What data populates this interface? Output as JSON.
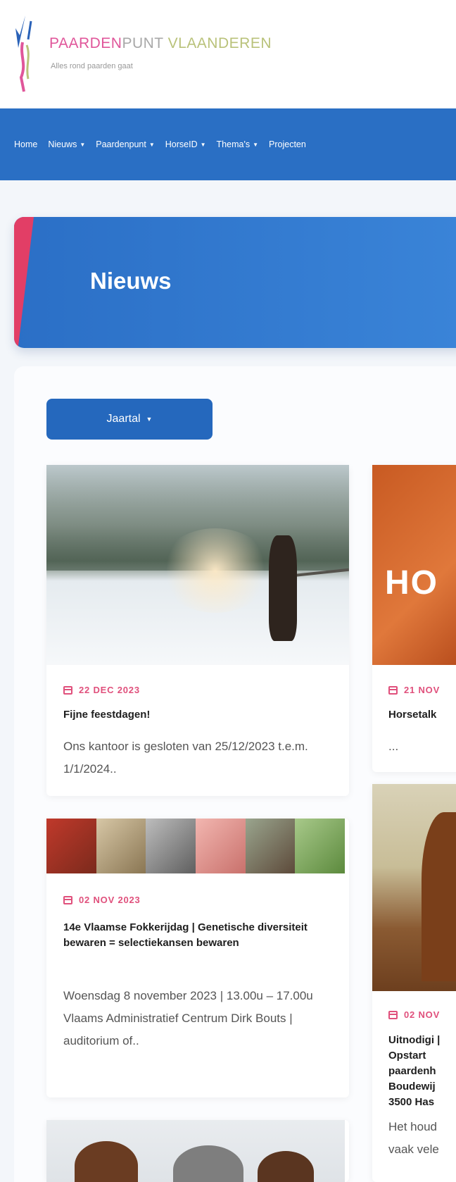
{
  "header": {
    "brand_part1": "PAARDEN",
    "brand_part2": "PUNT",
    "brand_part3": "VLAANDEREN",
    "tagline": "Alles rond paarden gaat",
    "colors": {
      "pink": "#e0569a",
      "grey": "#a8a8a8",
      "olive": "#b9c27a"
    }
  },
  "nav": {
    "items": [
      {
        "label": "Home",
        "dropdown": false
      },
      {
        "label": "Nieuws",
        "dropdown": true
      },
      {
        "label": "Paardenpunt",
        "dropdown": true
      },
      {
        "label": "HorseID",
        "dropdown": true
      },
      {
        "label": "Thema's",
        "dropdown": true
      },
      {
        "label": "Projecten",
        "dropdown": false
      }
    ],
    "color": "#2a6fc4"
  },
  "hero": {
    "title": "Nieuws",
    "accent": "#e23e66"
  },
  "filter": {
    "year_label": "Jaartal"
  },
  "cards": [
    {
      "date": "22 DEC 2023",
      "title": "Fijne feestdagen!",
      "excerpt": "Ons kantoor is gesloten van 25/12/2023 t.e.m. 1/1/2024.."
    },
    {
      "date": "02 NOV 2023",
      "title": "14e Vlaamse Fokkerijdag | Genetische diversiteit bewaren = selectiekansen bewaren",
      "excerpt": "Woensdag 8 november 2023 | 13.00u – 17.00u Vlaams Administratief Centrum Dirk Bouts | auditorium of.."
    },
    {
      "date": "21 NOV",
      "title": "Horsetalk",
      "excerpt": "..."
    },
    {
      "date": "02 NOV",
      "title": "Uitnodigi | Opstart paardenh Boudewij 3500 Has",
      "excerpt": "Het houd vaak vele"
    }
  ],
  "images": {
    "horsetalk_text": "HO"
  }
}
